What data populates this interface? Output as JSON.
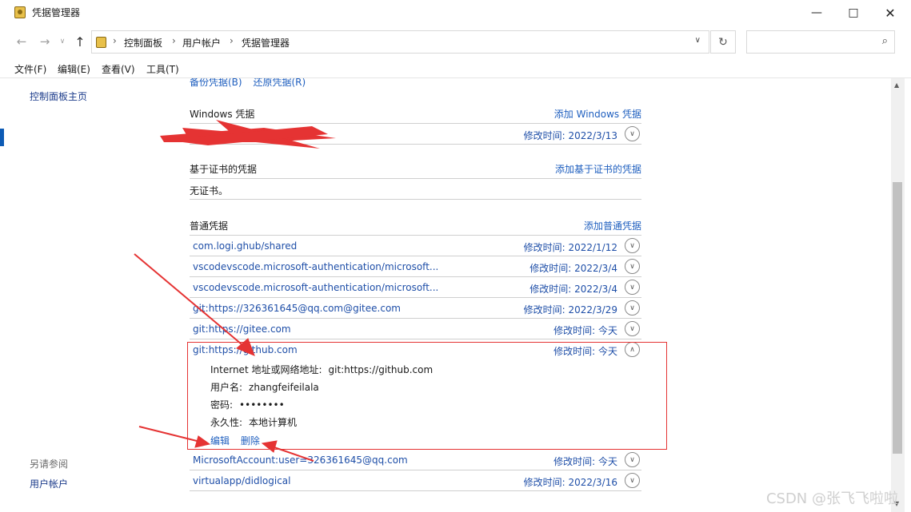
{
  "window": {
    "title": "凭据管理器"
  },
  "nav": {
    "breadcrumbs": [
      "控制面板",
      "用户帐户",
      "凭据管理器"
    ]
  },
  "menu": [
    "文件(F)",
    "编辑(E)",
    "查看(V)",
    "工具(T)"
  ],
  "left": {
    "home": "控制面板主页",
    "see_also": "另请参阅",
    "user_accounts": "用户帐户"
  },
  "main": {
    "backup": "备份凭据(B)",
    "restore": "还原凭据(R)",
    "windows": {
      "title": "Windows 凭据",
      "add": "添加 Windows 凭据",
      "rows": [
        {
          "name": "",
          "modified": "修改时间:  2022/3/13"
        }
      ]
    },
    "cert": {
      "title": "基于证书的凭据",
      "add": "添加基于证书的凭据",
      "empty": "无证书。"
    },
    "generic": {
      "title": "普通凭据",
      "add": "添加普通凭据",
      "rows": [
        {
          "name": "com.logi.ghub/shared",
          "modified": "修改时间:  2022/1/12"
        },
        {
          "name": "vscodevscode.microsoft-authentication/microsoft...",
          "modified": "修改时间:  2022/3/4"
        },
        {
          "name": "vscodevscode.microsoft-authentication/microsoft...",
          "modified": "修改时间:  2022/3/4"
        },
        {
          "name": "git:https://326361645@qq.com@gitee.com",
          "modified": "修改时间:  2022/3/29"
        },
        {
          "name": "git:https://gitee.com",
          "modified": "修改时间:  今天"
        }
      ],
      "expanded": {
        "name": "git:https://github.com",
        "modified": "修改时间:  今天",
        "address_label": "Internet 地址或网络地址:",
        "address_value": "git:https://github.com",
        "user_label": "用户名:",
        "user_value": "zhangfeifeilala",
        "password_label": "密码:",
        "password_value": "••••••••",
        "persist_label": "永久性:",
        "persist_value": "本地计算机",
        "edit": "编辑",
        "delete": "删除"
      },
      "after_rows": [
        {
          "name": "MicrosoftAccount:user=326361645@qq.com",
          "modified": "修改时间:  今天"
        },
        {
          "name": "virtualapp/didlogical",
          "modified": "修改时间:  2022/3/16"
        }
      ]
    }
  },
  "watermark": "CSDN @张飞飞啦啦",
  "colors": {
    "link": "#1f5fbf",
    "annotation": "#e53333"
  }
}
